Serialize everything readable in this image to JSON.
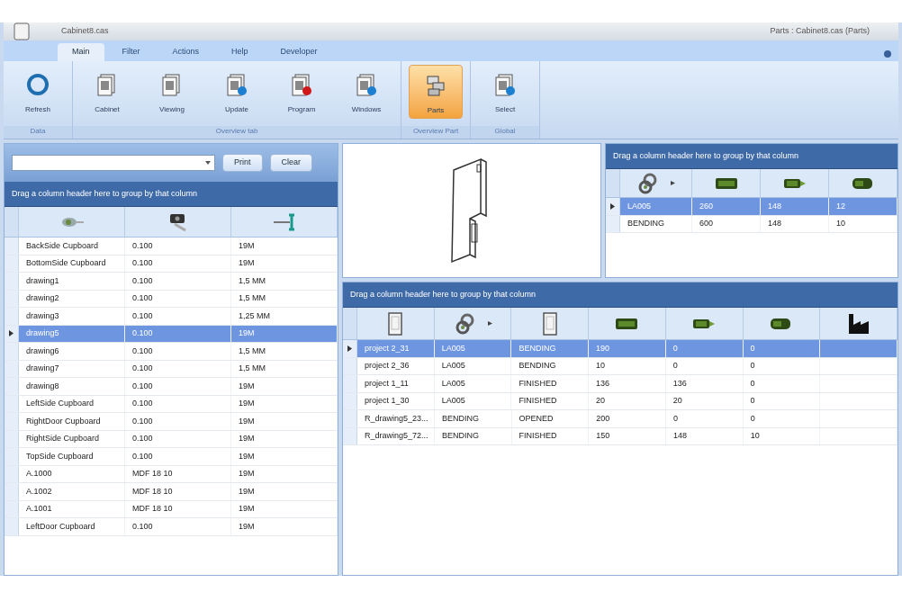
{
  "window": {
    "app_name": "Cabinet8.cas",
    "title": "Parts : Cabinet8.cas (Parts)"
  },
  "ribbon_tabs": [
    {
      "label": "Main",
      "selected": true
    },
    {
      "label": "Filter",
      "selected": false
    },
    {
      "label": "Actions",
      "selected": false
    },
    {
      "label": "Help",
      "selected": false
    },
    {
      "label": "Developer",
      "selected": false
    }
  ],
  "ribbon_groups": [
    {
      "label": "Data",
      "buttons": [
        {
          "label": "Refresh",
          "kind": "refresh",
          "selected": false
        }
      ]
    },
    {
      "label": "Overview tab",
      "buttons": [
        {
          "label": "Cabinet",
          "kind": "doc",
          "selected": false
        },
        {
          "label": "Viewing",
          "kind": "doc",
          "selected": false
        },
        {
          "label": "Update",
          "kind": "doc-blue",
          "selected": false
        },
        {
          "label": "Program",
          "kind": "doc-red",
          "selected": false
        },
        {
          "label": "Windows",
          "kind": "doc-blue",
          "selected": false
        }
      ]
    },
    {
      "label": "Overview Part",
      "buttons": [
        {
          "label": "Parts",
          "kind": "parts",
          "selected": true
        }
      ]
    },
    {
      "label": "Global",
      "buttons": [
        {
          "label": "Select",
          "kind": "doc-blue",
          "selected": false
        }
      ]
    }
  ],
  "search": {
    "buttons": [
      "Print",
      "Clear"
    ]
  },
  "parts_table": {
    "group_hint": "Drag a column header here to group by that column",
    "columns": [
      {
        "kind": "tool"
      },
      {
        "kind": "stamp"
      },
      {
        "kind": "ruler"
      }
    ],
    "rows": [
      {
        "cells": [
          "BackSide Cupboard",
          "0.100",
          "19M"
        ],
        "selected": false
      },
      {
        "cells": [
          "BottomSide Cupboard",
          "0.100",
          "19M"
        ],
        "selected": false
      },
      {
        "cells": [
          "drawing1",
          "0.100",
          "1,5 MM"
        ],
        "selected": false
      },
      {
        "cells": [
          "drawing2",
          "0.100",
          "1,5 MM"
        ],
        "selected": false
      },
      {
        "cells": [
          "drawing3",
          "0.100",
          "1,25 MM"
        ],
        "selected": false
      },
      {
        "cells": [
          "drawing5",
          "0.100",
          "19M"
        ],
        "selected": true
      },
      {
        "cells": [
          "drawing6",
          "0.100",
          "1,5 MM"
        ],
        "selected": false
      },
      {
        "cells": [
          "drawing7",
          "0.100",
          "1,5 MM"
        ],
        "selected": false
      },
      {
        "cells": [
          "drawing8",
          "0.100",
          "19M"
        ],
        "selected": false
      },
      {
        "cells": [
          "LeftSide Cupboard",
          "0.100",
          "19M"
        ],
        "selected": false
      },
      {
        "cells": [
          "RightDoor Cupboard",
          "0.100",
          "19M"
        ],
        "selected": false
      },
      {
        "cells": [
          "RightSide Cupboard",
          "0.100",
          "19M"
        ],
        "selected": false
      },
      {
        "cells": [
          "TopSide Cupboard",
          "0.100",
          "19M"
        ],
        "selected": false
      },
      {
        "cells": [
          "A.1000",
          "MDF 18 10",
          "19M"
        ],
        "selected": false
      },
      {
        "cells": [
          "A.1002",
          "MDF 18 10",
          "19M"
        ],
        "selected": false
      },
      {
        "cells": [
          "A.1001",
          "MDF 18 10",
          "19M"
        ],
        "selected": false
      },
      {
        "cells": [
          "LeftDoor Cupboard",
          "0.100",
          "19M"
        ],
        "selected": false
      }
    ]
  },
  "summary_table": {
    "group_hint": "Drag a column header here to group by that column",
    "columns": [
      {
        "kind": "link"
      },
      {
        "kind": "green"
      },
      {
        "kind": "green-flag"
      },
      {
        "kind": "green-half"
      }
    ],
    "rows": [
      {
        "cells": [
          "LA005",
          "260",
          "148",
          "12"
        ],
        "selected": true
      },
      {
        "cells": [
          "BENDING",
          "600",
          "148",
          "10"
        ],
        "selected": false
      }
    ]
  },
  "orders_table": {
    "group_hint": "Drag a column header here to group by that column",
    "columns": [
      {
        "kind": "doc"
      },
      {
        "kind": "link"
      },
      {
        "kind": "doc"
      },
      {
        "kind": "green"
      },
      {
        "kind": "green-flag"
      },
      {
        "kind": "green-half"
      },
      {
        "kind": "factory"
      }
    ],
    "rows": [
      {
        "cells": [
          "project 2_31",
          "LA005",
          "BENDING",
          "190",
          "0",
          "0"
        ],
        "selected": true
      },
      {
        "cells": [
          "project 2_36",
          "LA005",
          "BENDING",
          "10",
          "0",
          "0"
        ],
        "selected": false
      },
      {
        "cells": [
          "project 1_11",
          "LA005",
          "FINISHED",
          "136",
          "136",
          "0"
        ],
        "selected": false
      },
      {
        "cells": [
          "project 1_30",
          "LA005",
          "FINISHED",
          "20",
          "20",
          "0"
        ],
        "selected": false
      },
      {
        "cells": [
          "R_drawing5_23...",
          "BENDING",
          "OPENED",
          "200",
          "0",
          "0"
        ],
        "selected": false
      },
      {
        "cells": [
          "R_drawing5_72...",
          "BENDING",
          "FINISHED",
          "150",
          "148",
          "10"
        ],
        "selected": false
      }
    ]
  }
}
